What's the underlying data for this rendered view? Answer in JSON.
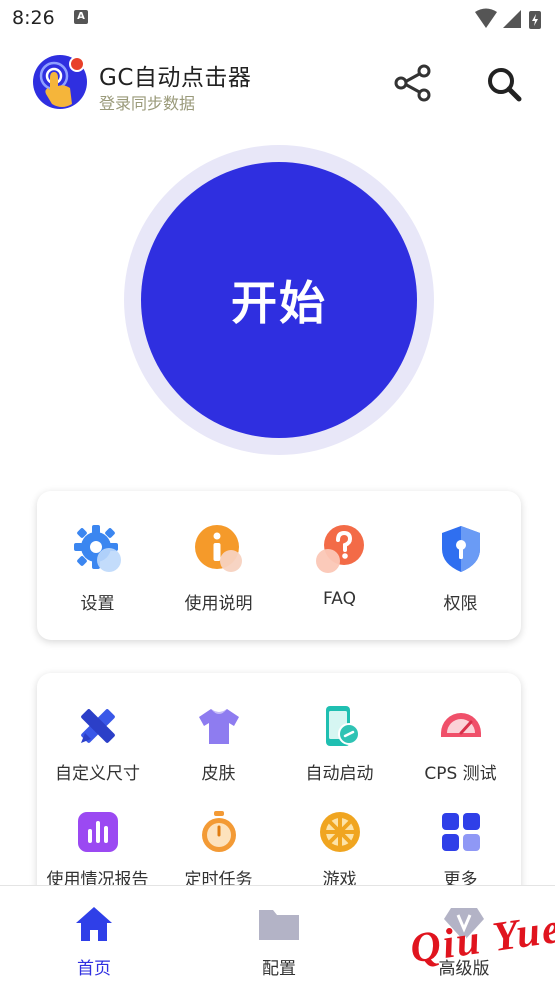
{
  "status_bar": {
    "time": "8:26",
    "notification_letter": "A"
  },
  "header": {
    "title": "GC自动点击器",
    "subtitle": "登录同步数据",
    "icons": [
      "share-icon",
      "search-icon"
    ]
  },
  "start_button": {
    "label": "开始"
  },
  "quick_actions": [
    {
      "label": "设置",
      "icon": "gear-icon"
    },
    {
      "label": "使用说明",
      "icon": "info-icon"
    },
    {
      "label": "FAQ",
      "icon": "question-icon"
    },
    {
      "label": "权限",
      "icon": "shield-icon"
    }
  ],
  "features": [
    {
      "label": "自定义尺寸",
      "icon": "ruler-pencil-icon"
    },
    {
      "label": "皮肤",
      "icon": "tshirt-icon"
    },
    {
      "label": "自动启动",
      "icon": "phone-link-icon"
    },
    {
      "label": "CPS 测试",
      "icon": "speedometer-icon"
    },
    {
      "label": "使用情况报告",
      "icon": "bar-chart-icon"
    },
    {
      "label": "定时任务",
      "icon": "stopwatch-icon"
    },
    {
      "label": "游戏",
      "icon": "wheel-icon"
    },
    {
      "label": "更多",
      "icon": "grid-icon"
    }
  ],
  "bottom_nav": [
    {
      "label": "首页",
      "icon": "home-icon",
      "active": true
    },
    {
      "label": "配置",
      "icon": "folder-icon",
      "active": false
    },
    {
      "label": "高级版",
      "icon": "diamond-icon",
      "active": false
    }
  ],
  "watermark": "Qiu Yue",
  "colors": {
    "primary": "#2f2fe0",
    "ring": "#e8e7f8",
    "subtitle": "#9a9a7a",
    "watermark": "#e0141e"
  }
}
